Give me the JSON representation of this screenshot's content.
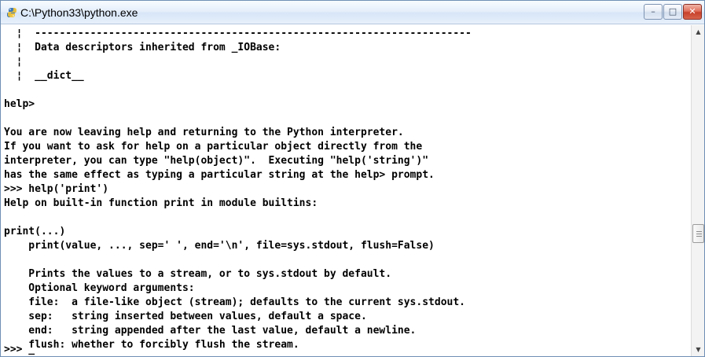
{
  "window": {
    "title": "C:\\Python33\\python.exe",
    "icon": "python-icon",
    "controls": {
      "minimize_icon": "–",
      "maximize_icon": "□",
      "close_icon": "✕"
    }
  },
  "console": {
    "lines": [
      "  ¦  -----------------------------------------------------------------------",
      "  ¦  Data descriptors inherited from _IOBase:",
      "  ¦",
      "  ¦  __dict__",
      "",
      "help>",
      "",
      "You are now leaving help and returning to the Python interpreter.",
      "If you want to ask for help on a particular object directly from the",
      "interpreter, you can type \"help(object)\".  Executing \"help('string')\"",
      "has the same effect as typing a particular string at the help> prompt.",
      ">>> help('print')",
      "Help on built-in function print in module builtins:",
      "",
      "print(...)",
      "    print(value, ..., sep=' ', end='\\n', file=sys.stdout, flush=False)",
      "",
      "    Prints the values to a stream, or to sys.stdout by default.",
      "    Optional keyword arguments:",
      "    file:  a file-like object (stream); defaults to the current sys.stdout.",
      "    sep:   string inserted between values, default a space.",
      "    end:   string appended after the last value, default a newline.",
      "    flush: whether to forcibly flush the stream.",
      "",
      ">>> _"
    ]
  },
  "scrollbar": {
    "up_icon": "▲",
    "down_icon": "▼",
    "position_fraction": 0.65
  }
}
